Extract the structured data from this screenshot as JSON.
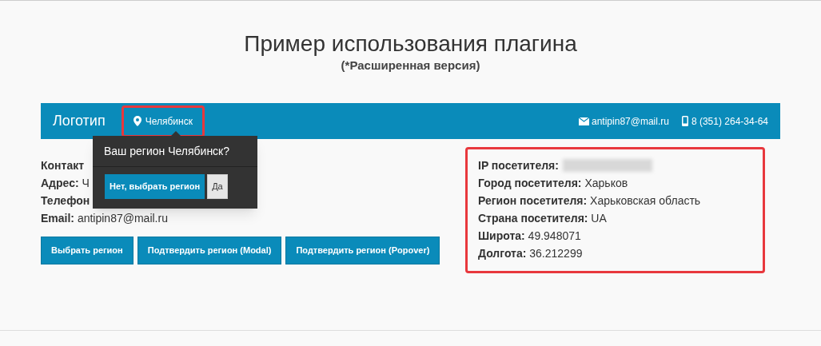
{
  "title": "Пример использования плагина",
  "subtitle": "(*Расширенная версия)",
  "header": {
    "logo": "Логотип",
    "city": "Челябинск",
    "city_highlighted": true,
    "email": "antipin87@mail.ru",
    "phone": "8 (351) 264-34-64"
  },
  "contacts": [
    {
      "label": "Контакт"
    },
    {
      "label": "Адрес:",
      "value": "Ч"
    },
    {
      "label": "Телефон"
    },
    {
      "label": "Email:",
      "value": "antipin87@mail.ru"
    }
  ],
  "buttons": [
    "Выбрать регион",
    "Подтвердить регион (Modal)",
    "Подтвердить регион (Popover)"
  ],
  "popover": {
    "title": "Ваш регион Челябинск?",
    "buttons": [
      {
        "label": "Нет, выбрать регион",
        "kind": "primary"
      },
      {
        "label": "Да",
        "kind": "default"
      }
    ]
  },
  "visitor_info": {
    "highlighted": true,
    "rows": [
      {
        "label": "IP посетителя:",
        "blurred": true
      },
      {
        "label": "Город посетителя:",
        "value": "Харьков",
        "blurred": false
      },
      {
        "label": "Регион посетителя:",
        "value": "Харьковская область",
        "blurred": false
      },
      {
        "label": "Страна посетителя:",
        "value": "UA",
        "blurred": false
      },
      {
        "label": "Широта:",
        "value": "49.948071",
        "blurred": false
      },
      {
        "label": "Долгота:",
        "value": "36.212299",
        "blurred": false
      }
    ]
  }
}
